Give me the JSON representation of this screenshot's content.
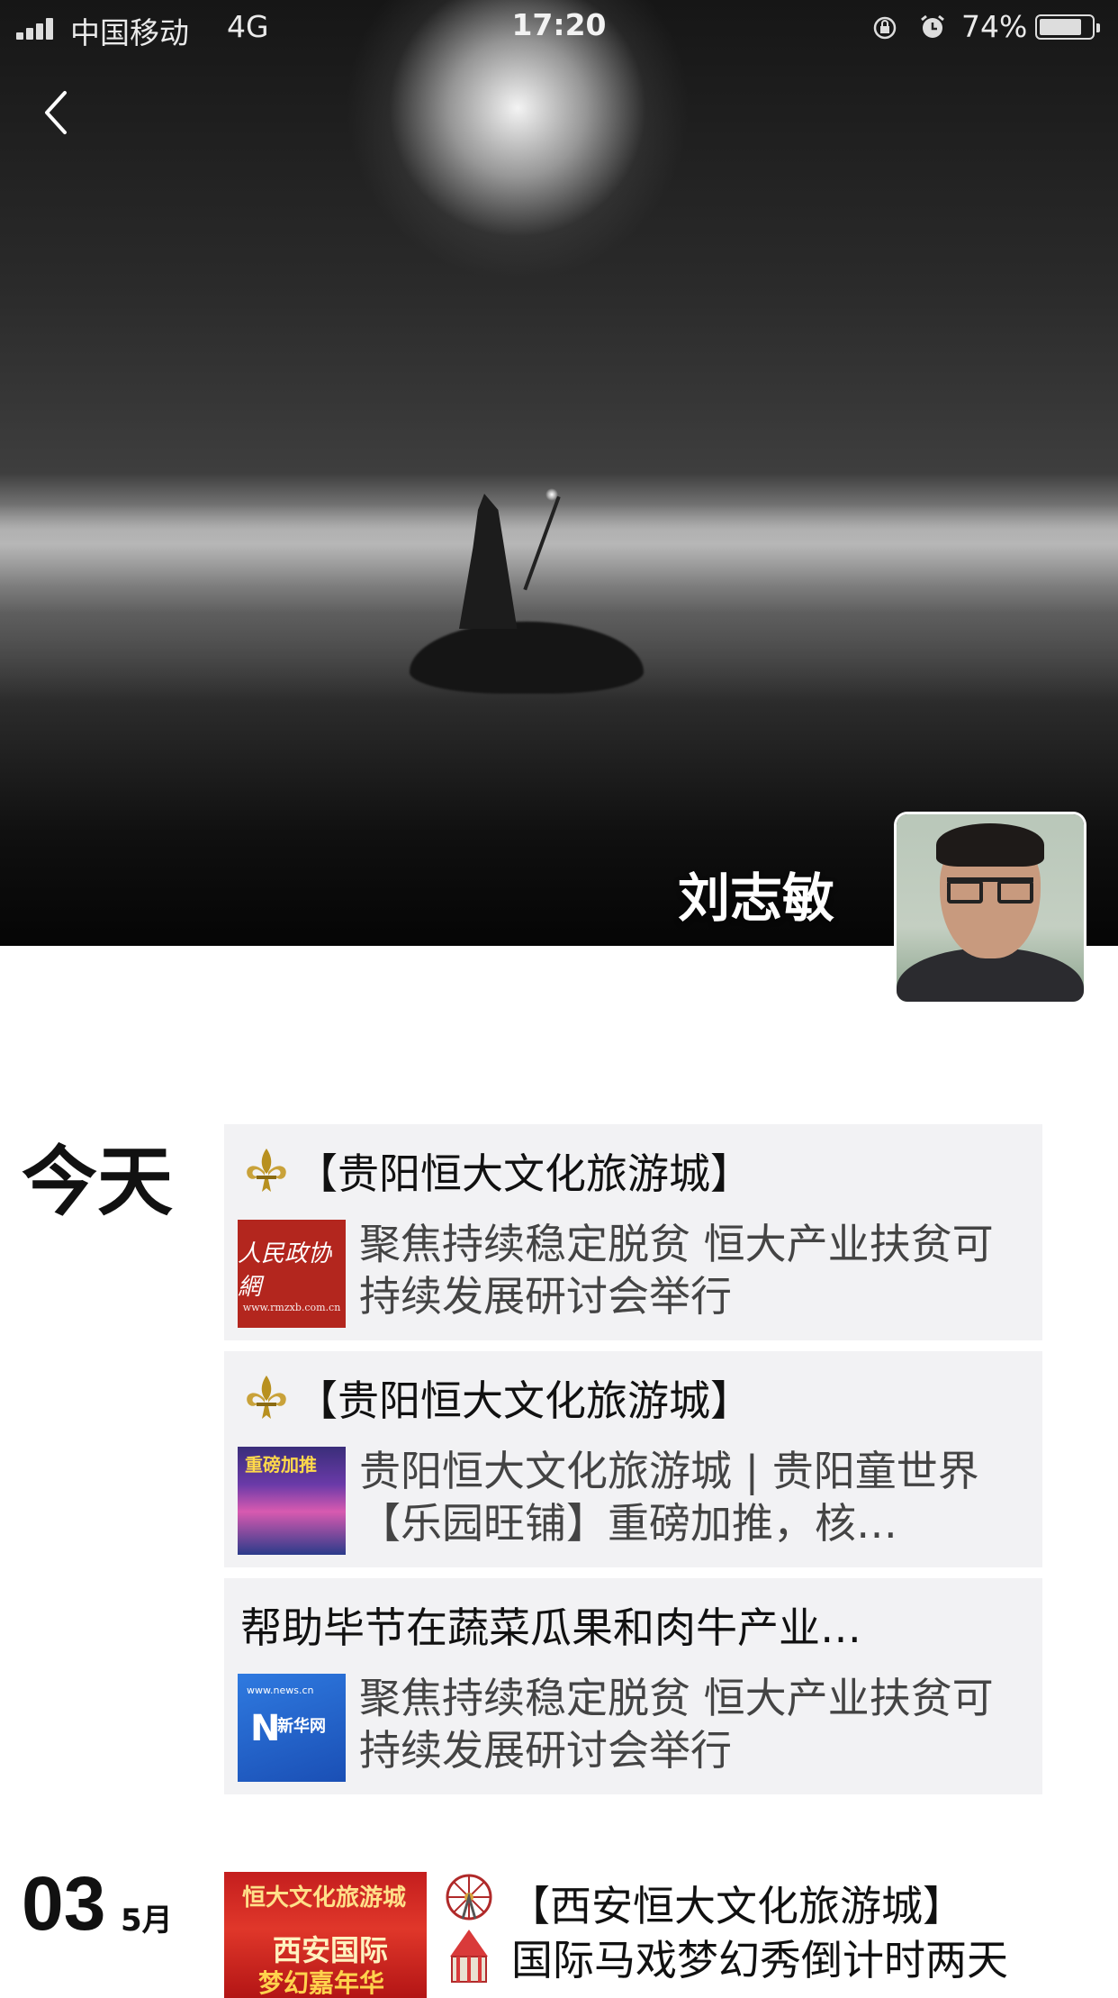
{
  "status_bar": {
    "carrier": "中国移动",
    "network": "4G",
    "time": "17:20",
    "battery_percent": "74%",
    "icons": [
      "signal-icon",
      "orientation-lock-icon",
      "alarm-icon",
      "battery-icon"
    ]
  },
  "header": {
    "back_icon": "chevron-left-icon",
    "cover_image": "wizard-on-rock-in-mist",
    "profile_name": "刘志敏",
    "avatar": "user-avatar-photo"
  },
  "feed": {
    "today_label": "今天",
    "items": [
      {
        "source": "【贵阳恒大文化旅游城】",
        "source_icon": "fleur-de-lis-icon",
        "thumb": "rmzxb-logo",
        "thumb_text": "人民政协網",
        "thumb_sub": "www.rmzxb.com.cn",
        "desc": "聚焦持续稳定脱贫 恒大产业扶贫可持续发展研讨会举行"
      },
      {
        "source": "【贵阳恒大文化旅游城】",
        "source_icon": "fleur-de-lis-icon",
        "thumb": "promo-poster",
        "thumb_text": "重磅加推",
        "desc": "贵阳恒大文化旅游城 | 贵阳童世界【乐园旺铺】重磅加推，核…"
      },
      {
        "source": "帮助毕节在蔬菜瓜果和肉牛产业…",
        "source_icon": "",
        "thumb": "xinhua-news-logo",
        "thumb_text": "新华网",
        "thumb_sub": "www.news.cn",
        "desc": "聚焦持续稳定脱贫 恒大产业扶贫可持续发展研讨会举行"
      }
    ],
    "next_date": {
      "day": "03",
      "month": "5月",
      "thumb_lines": [
        "恒大文化旅游城",
        "西安国际",
        "梦幻嘉年华"
      ],
      "icon": "ferris-wheel-circus-icon",
      "title": "【西安恒大文化旅游城】",
      "subtitle": "国际马戏梦幻秀倒计时两天"
    }
  }
}
